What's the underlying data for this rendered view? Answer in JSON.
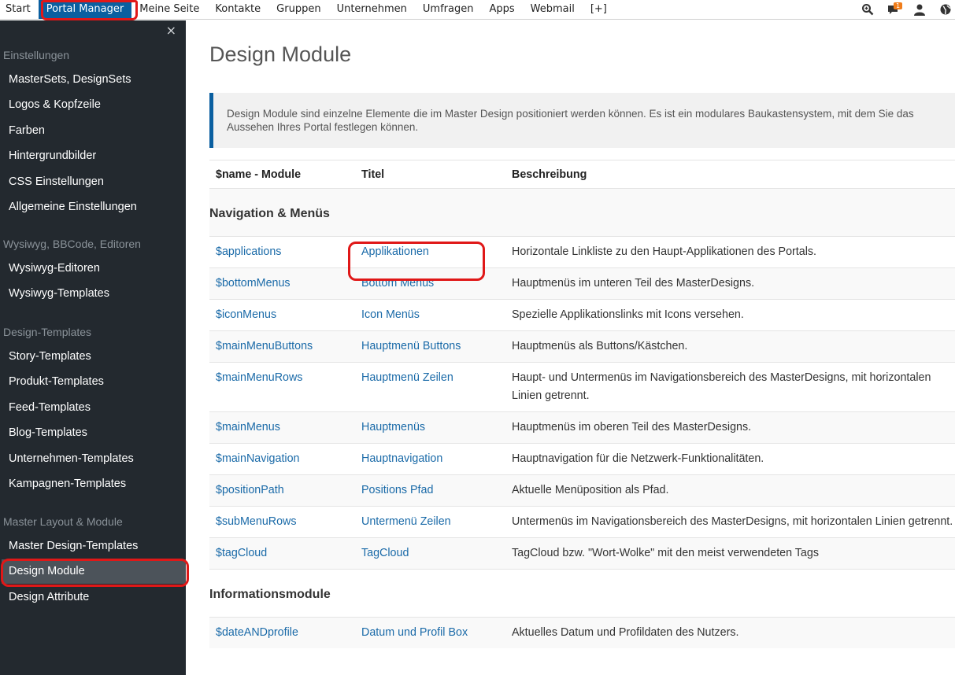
{
  "topnav": {
    "items": [
      "Start",
      "Portal Manager",
      "Meine Seite",
      "Kontakte",
      "Gruppen",
      "Unternehmen",
      "Umfragen",
      "Apps",
      "Webmail",
      "[+]"
    ],
    "active_index": 1,
    "notification_count": "1"
  },
  "sidebar": {
    "close_label": "×",
    "groups": [
      {
        "title": "Einstellungen",
        "items": [
          "MasterSets, DesignSets",
          "Logos & Kopfzeile",
          "Farben",
          "Hintergrundbilder",
          "CSS Einstellungen",
          "Allgemeine Einstellungen"
        ]
      },
      {
        "title": "Wysiwyg, BBCode, Editoren",
        "items": [
          "Wysiwyg-Editoren",
          "Wysiwyg-Templates"
        ]
      },
      {
        "title": "Design-Templates",
        "items": [
          "Story-Templates",
          "Produkt-Templates",
          "Feed-Templates",
          "Blog-Templates",
          "Unternehmen-Templates",
          "Kampagnen-Templates"
        ]
      },
      {
        "title": "Master Layout & Module",
        "items": [
          "Master Design-Templates",
          "Design Module",
          "Design Attribute"
        ]
      }
    ],
    "active_item": "Design Module"
  },
  "main": {
    "title": "Design Module",
    "note": "Design Module sind einzelne Elemente die im Master Design positioniert werden können. Es ist ein modulares Baukastensystem, mit dem Sie das Aussehen Ihres Portal festlegen können.",
    "table": {
      "headers": [
        "$name - Module",
        "Titel",
        "Beschreibung"
      ],
      "sections": [
        {
          "title": "Navigation & Menüs",
          "rows": [
            [
              "$applications",
              "Applikationen",
              "Horizontale Linkliste zu den Haupt-Applikationen des Portals."
            ],
            [
              "$bottomMenus",
              "Bottom Menüs",
              "Hauptmenüs im unteren Teil des MasterDesigns."
            ],
            [
              "$iconMenus",
              "Icon Menüs",
              "Spezielle Applikationslinks mit Icons versehen."
            ],
            [
              "$mainMenuButtons",
              "Hauptmenü Buttons",
              "Hauptmenüs als Buttons/Kästchen."
            ],
            [
              "$mainMenuRows",
              "Hauptmenü Zeilen",
              "Haupt- und Untermenüs im Navigationsbereich des MasterDesigns, mit horizontalen Linien getrennt."
            ],
            [
              "$mainMenus",
              "Hauptmenüs",
              "Hauptmenüs im oberen Teil des MasterDesigns."
            ],
            [
              "$mainNavigation",
              "Hauptnavigation",
              "Hauptnavigation für die Netzwerk-Funktionalitäten."
            ],
            [
              "$positionPath",
              "Positions Pfad",
              "Aktuelle Menüposition als Pfad."
            ],
            [
              "$subMenuRows",
              "Untermenü Zeilen",
              "Untermenüs im Navigationsbereich des MasterDesigns, mit horizontalen Linien getrennt."
            ],
            [
              "$tagCloud",
              "TagCloud",
              "TagCloud bzw. \"Wort-Wolke\" mit den meist verwendeten Tags"
            ]
          ]
        },
        {
          "title": "Informationsmodule",
          "rows": [
            [
              "$dateANDprofile",
              "Datum und Profil Box",
              "Aktuelles Datum und Profildaten des Nutzers."
            ]
          ]
        }
      ]
    }
  },
  "icons": [
    "search-icon",
    "chat-icon",
    "user-icon",
    "globe-icon"
  ],
  "colors": {
    "accent": "#0a5fa0",
    "sidebar_bg": "#23292f",
    "link": "#1a6aa8",
    "annotation": "#e01818",
    "badge": "#f07d1a"
  }
}
